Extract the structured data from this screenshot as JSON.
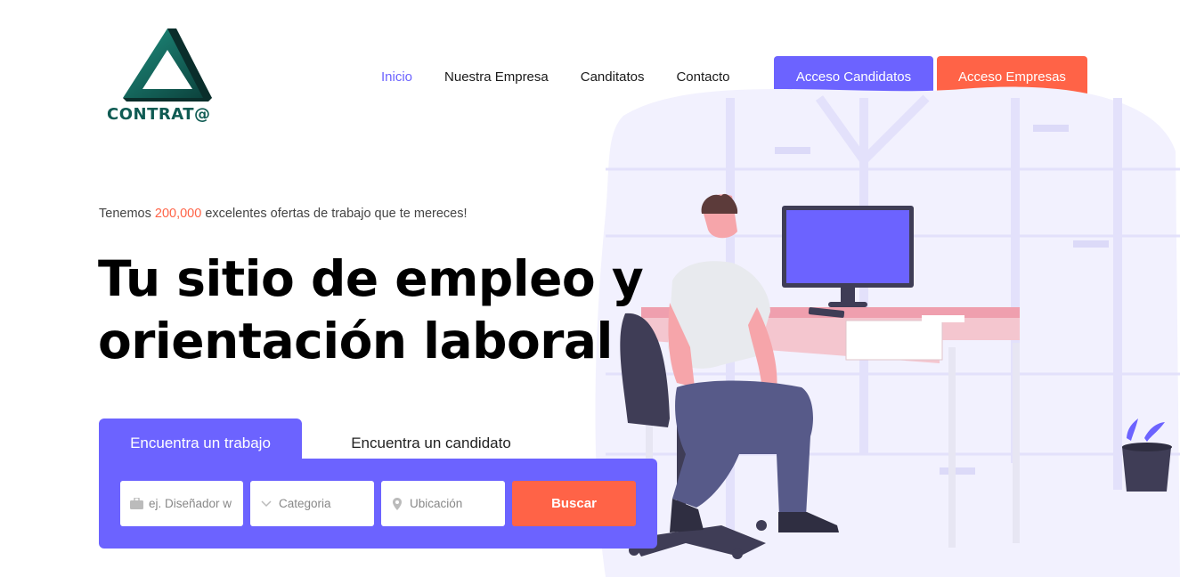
{
  "brand": {
    "logo_text": "CONTRAT@",
    "colors": {
      "logo": "#0f5b53",
      "accent": "#6c63ff",
      "cta": "#ff6347"
    }
  },
  "nav": {
    "items": [
      {
        "label": "Inicio",
        "active": true
      },
      {
        "label": "Nuestra Empresa"
      },
      {
        "label": "Canditatos"
      },
      {
        "label": "Contacto"
      }
    ],
    "candidates_button": "Acceso Candidatos",
    "companies_button": "Acceso Empresas"
  },
  "hero": {
    "tagline_prefix": "Tenemos ",
    "tagline_highlight": "200,000",
    "tagline_suffix": " excelentes ofertas de trabajo que te mereces!",
    "headline_line1": "Tu sitio de empleo y",
    "headline_line2": "orientación laboral"
  },
  "search": {
    "tabs": {
      "active": "Encuentra un trabajo",
      "inactive": "Encuentra un candidato"
    },
    "job_placeholder": "ej. Diseñador w",
    "category_placeholder": "Categoria",
    "location_placeholder": "Ubicación",
    "submit_label": "Buscar",
    "icons": [
      "briefcase-icon",
      "chevron-down-icon",
      "location-pin-icon"
    ]
  }
}
